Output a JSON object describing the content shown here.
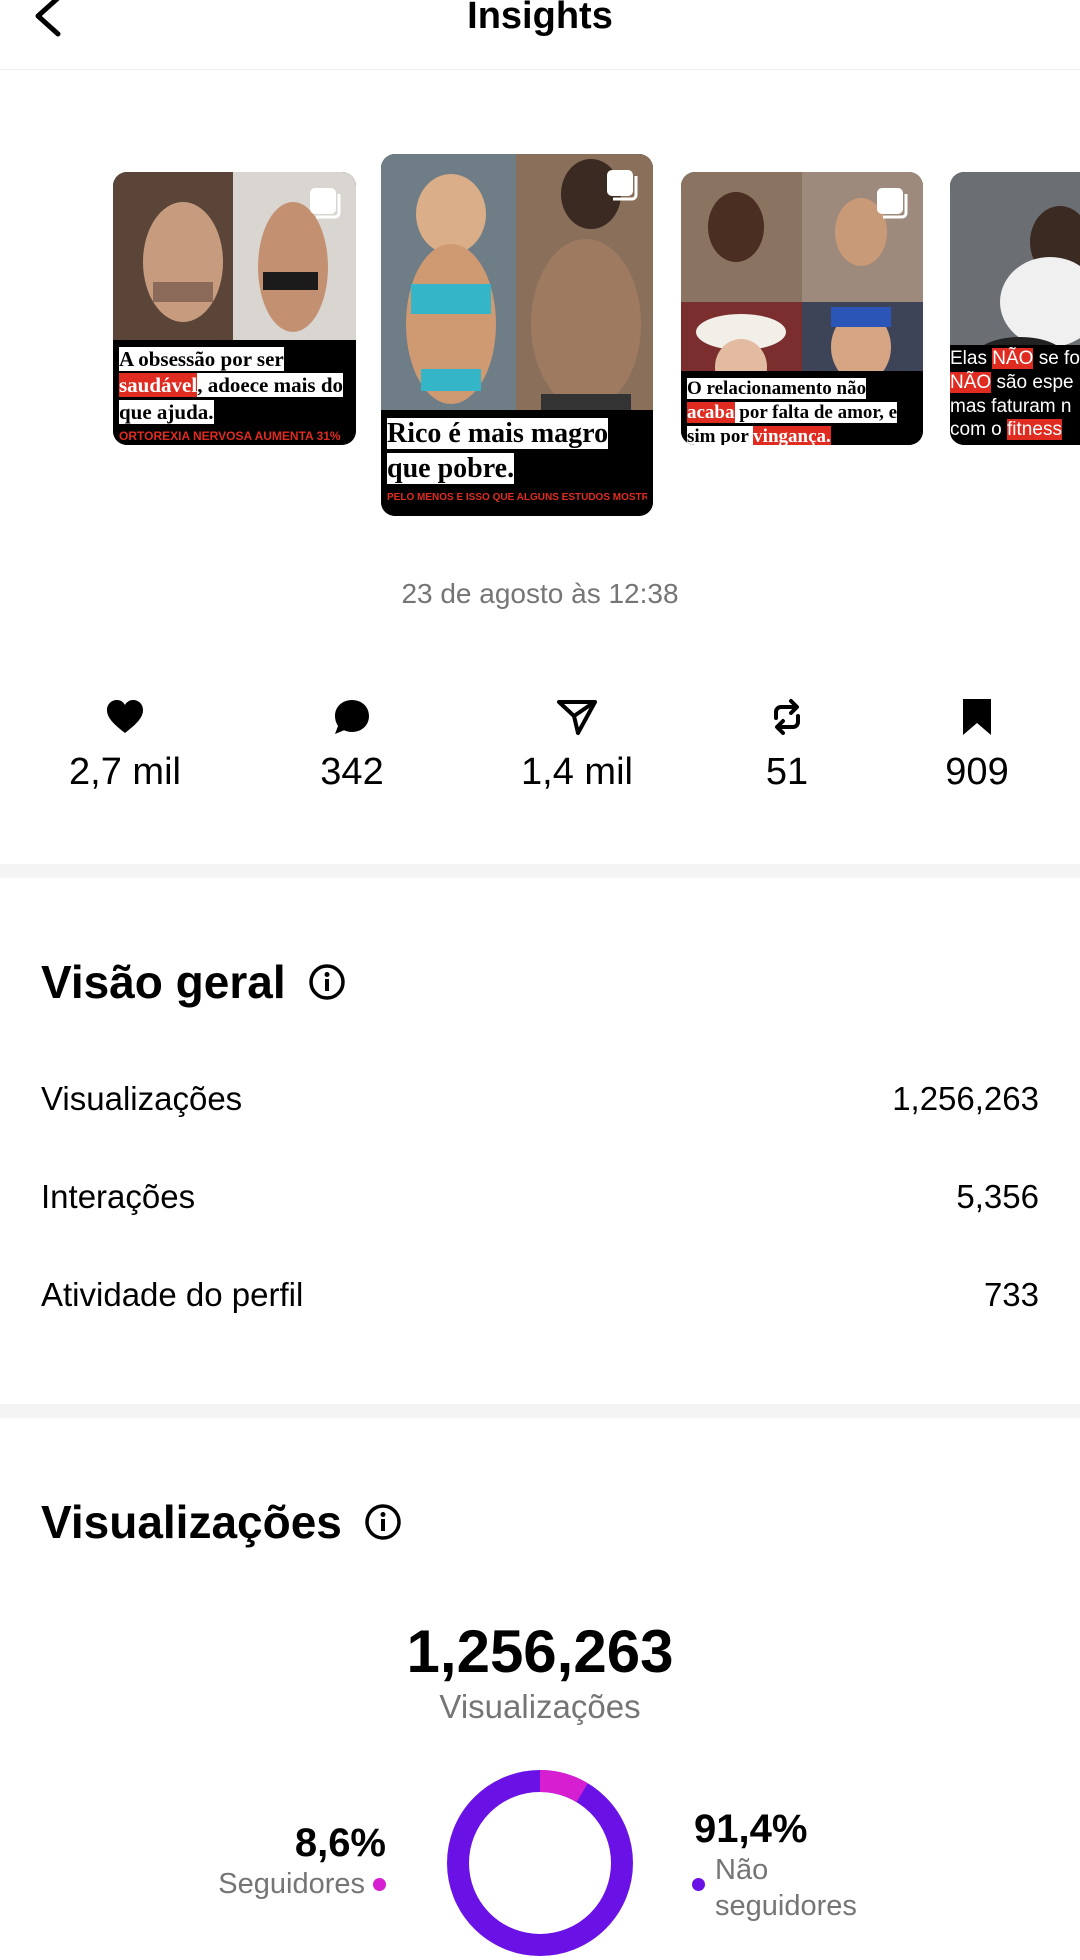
{
  "header": {
    "title": "Insights"
  },
  "posts": [
    {
      "caption_parts": [
        {
          "text": "A obsessão por ser",
          "red": false
        },
        {
          "text": "saudável",
          "red": true
        },
        {
          "text": ", adoece mais do que ajuda.",
          "red": false
        }
      ],
      "subline": "ORTOREXIA NERVOSA AUMENTA 31%"
    },
    {
      "caption_parts": [
        {
          "text": "Rico é mais magro que pobre.",
          "red": false
        }
      ],
      "subline": "PELO MENOS É ISSO QUE ALGUNS ESTUDOS MOSTRAM..."
    },
    {
      "caption_parts": [
        {
          "text": "O relacionamento não",
          "red": false
        },
        {
          "text": "acaba",
          "red": true
        },
        {
          "text": " por falta de amor, e sim por ",
          "red": false
        },
        {
          "text": "vingança.",
          "red": true
        }
      ],
      "subline": ""
    },
    {
      "caption_parts": [
        {
          "text": "Elas ",
          "red": false
        },
        {
          "text": "NÃO",
          "red": true
        },
        {
          "text": " se fo",
          "red": false
        },
        {
          "text": "NÃO",
          "red": true
        },
        {
          "text": " são espe",
          "red": false
        },
        {
          "text": "mas faturam n",
          "red": false
        },
        {
          "text": "com o ",
          "red": false
        },
        {
          "text": "fitness",
          "red": true
        }
      ],
      "subline": ""
    }
  ],
  "post_date": "23 de agosto às 12:38",
  "stats": [
    {
      "icon": "heart-icon",
      "value": "2,7 mil"
    },
    {
      "icon": "comment-icon",
      "value": "342"
    },
    {
      "icon": "share-icon",
      "value": "1,4 mil"
    },
    {
      "icon": "repost-icon",
      "value": "51"
    },
    {
      "icon": "bookmark-icon",
      "value": "909"
    }
  ],
  "overview": {
    "title": "Visão geral",
    "rows": [
      {
        "label": "Visualizações",
        "value": "1,256,263"
      },
      {
        "label": "Interações",
        "value": "5,356"
      },
      {
        "label": "Atividade do perfil",
        "value": "733"
      }
    ]
  },
  "views": {
    "title": "Visualizações",
    "total": "1,256,263",
    "total_label": "Visualizações",
    "followers_pct": "8,6%",
    "followers_label": "Seguidores",
    "nonfollowers_pct": "91,4%",
    "nonfollowers_label_1": "Não",
    "nonfollowers_label_2": "seguidores",
    "followers_fraction": 0.086,
    "colors": {
      "followers": "#d61fd0",
      "nonfollowers": "#6a12e6"
    }
  }
}
